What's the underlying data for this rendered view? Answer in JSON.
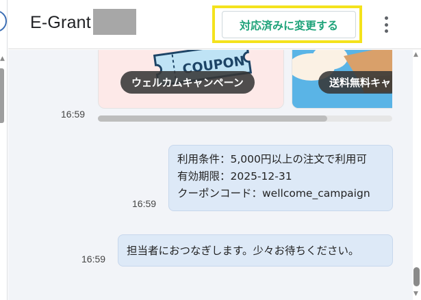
{
  "header": {
    "title": "E-Grant",
    "status_button_label": "対応済みに変更する",
    "more_icon": "more-vertical-icon"
  },
  "carousel": {
    "cards": [
      {
        "label": "ウェルカムキャンペーン",
        "image_text": "COUPON"
      },
      {
        "label": "送料無料キャ"
      }
    ],
    "time": "16:59",
    "scroll_fraction": 0.78
  },
  "messages": [
    {
      "time": "16:59",
      "lines": [
        "利用条件：5,000円以上の注文で利用可",
        "有効期限：2025-12-31",
        "クーポンコード：wellcome_campaign"
      ]
    },
    {
      "time": "16:59",
      "lines": [
        "担当者におつなぎします。少々お待ちください。"
      ]
    }
  ],
  "colors": {
    "accent_green": "#1fa37a",
    "highlight_yellow": "#f4e21c",
    "bubble_bg": "#dde9f7",
    "chat_bg": "#f2f4f8"
  }
}
